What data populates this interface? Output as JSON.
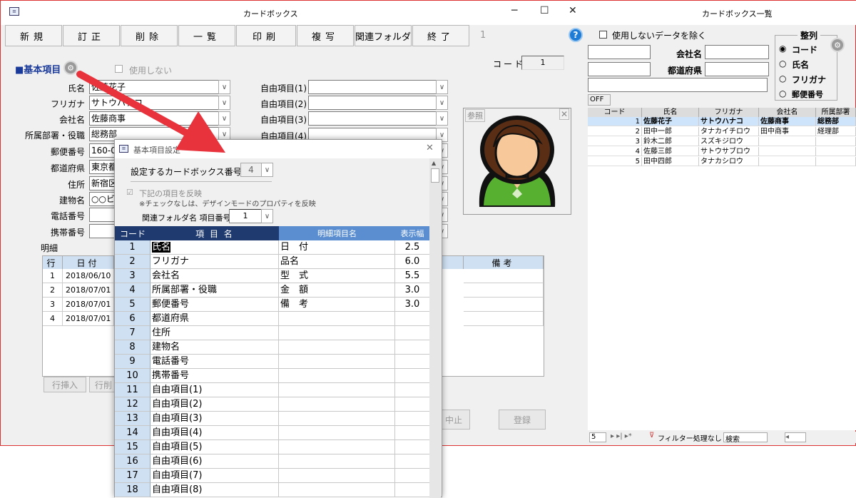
{
  "main": {
    "title": "カードボックス",
    "toolbar": {
      "new": "新規",
      "edit": "訂正",
      "delete": "削除",
      "list": "一覧",
      "print": "印刷",
      "copy": "複写",
      "folder": "関連フォルダ",
      "exit": "終了",
      "page": "1"
    },
    "section_title": "■基本項目",
    "unused_label": "使用しない",
    "code_label": "コード",
    "code_value": "1",
    "fields": [
      {
        "label": "氏名",
        "value": "佐藤花子"
      },
      {
        "label": "フリガナ",
        "value": "サトウハナコ"
      },
      {
        "label": "会社名",
        "value": "佐藤商事"
      },
      {
        "label": "所属部署・役職",
        "value": "総務部"
      },
      {
        "label": "郵便番号",
        "value": "160-0023"
      },
      {
        "label": "都道府県",
        "value": "東京都"
      },
      {
        "label": "住所",
        "value": "新宿区"
      },
      {
        "label": "建物名",
        "value": "○○ビル"
      },
      {
        "label": "電話番号",
        "value": ""
      },
      {
        "label": "携帯番号",
        "value": ""
      }
    ],
    "free_fields": [
      "自由項目(1)",
      "自由項目(2)",
      "自由項目(3)",
      "自由項目(4)"
    ],
    "photo_label": "参照",
    "detail_title": "明細",
    "detail_headers": {
      "row": "行",
      "date": "日付",
      "note": "備考"
    },
    "detail_rows": [
      {
        "row": "1",
        "date": "2018/06/10"
      },
      {
        "row": "2",
        "date": "2018/07/01"
      },
      {
        "row": "3",
        "date": "2018/07/01"
      },
      {
        "row": "4",
        "date": "2018/07/01"
      }
    ],
    "row_insert": "行挿入",
    "row_delete": "行削",
    "cancel": "中止",
    "register": "登録"
  },
  "list": {
    "title": "カードボックス一覧",
    "exclude_unused": "使用しないデータを除く",
    "company_label": "会社名",
    "pref_label": "都道府県",
    "sort_title": "整列",
    "sort_options": [
      "コード",
      "氏名",
      "フリガナ",
      "郵便番号"
    ],
    "off_label": "OFF",
    "headers": [
      "コード",
      "氏名",
      "フリガナ",
      "会社名",
      "所属部署"
    ],
    "rows": [
      {
        "code": "1",
        "name": "佐藤花子",
        "kana": "サトウハナコ",
        "company": "佐藤商事",
        "dept": "総務部"
      },
      {
        "code": "2",
        "name": "田中一郎",
        "kana": "タナカイチロウ",
        "company": "田中商事",
        "dept": "経理部"
      },
      {
        "code": "3",
        "name": "鈴木二郎",
        "kana": "スズキジロウ",
        "company": "",
        "dept": ""
      },
      {
        "code": "4",
        "name": "佐藤三郎",
        "kana": "サトウサブロウ",
        "company": "",
        "dept": ""
      },
      {
        "code": "5",
        "name": "田中四郎",
        "kana": "タナカシロウ",
        "company": "",
        "dept": ""
      }
    ],
    "nav_record": "5",
    "filter_label": "フィルター処理なし",
    "search_label": "検索"
  },
  "dialog": {
    "title": "基本項目設定",
    "box_num_label": "設定するカードボックス番号",
    "box_num_value": "4",
    "reflect_label": "下記の項目を反映",
    "reflect_note": "※チェックなしは、デザインモードのプロパティを反映",
    "folder_label": "関連フォルダ名 項目番号",
    "folder_value": "1",
    "headers": {
      "code": "コード",
      "item": "項 目 名",
      "detail": "明細項目名",
      "width": "表示幅"
    },
    "items": [
      {
        "code": "1",
        "name": "氏名",
        "detail": "日　付",
        "width": "2.5"
      },
      {
        "code": "2",
        "name": "フリガナ",
        "detail": "品名",
        "width": "6.0"
      },
      {
        "code": "3",
        "name": "会社名",
        "detail": "型　式",
        "width": "5.5"
      },
      {
        "code": "4",
        "name": "所属部署・役職",
        "detail": "金　額",
        "width": "3.0"
      },
      {
        "code": "5",
        "name": "郵便番号",
        "detail": "備　考",
        "width": "3.0"
      },
      {
        "code": "6",
        "name": "都道府県",
        "detail": "",
        "width": ""
      },
      {
        "code": "7",
        "name": "住所",
        "detail": "",
        "width": ""
      },
      {
        "code": "8",
        "name": "建物名",
        "detail": "",
        "width": ""
      },
      {
        "code": "9",
        "name": "電話番号",
        "detail": "",
        "width": ""
      },
      {
        "code": "10",
        "name": "携帯番号",
        "detail": "",
        "width": ""
      },
      {
        "code": "11",
        "name": "自由項目(1)",
        "detail": "",
        "width": ""
      },
      {
        "code": "12",
        "name": "自由項目(2)",
        "detail": "",
        "width": ""
      },
      {
        "code": "13",
        "name": "自由項目(3)",
        "detail": "",
        "width": ""
      },
      {
        "code": "14",
        "name": "自由項目(4)",
        "detail": "",
        "width": ""
      },
      {
        "code": "15",
        "name": "自由項目(5)",
        "detail": "",
        "width": ""
      },
      {
        "code": "16",
        "name": "自由項目(6)",
        "detail": "",
        "width": ""
      },
      {
        "code": "17",
        "name": "自由項目(7)",
        "detail": "",
        "width": ""
      },
      {
        "code": "18",
        "name": "自由項目(8)",
        "detail": "",
        "width": ""
      }
    ]
  },
  "colors": {
    "header_dark": "#1e3a6e",
    "header_blue": "#5a8ed0",
    "arrow": "#e8323c",
    "code_col": "#cfe0f2",
    "selected_row": "#cde4fb"
  }
}
